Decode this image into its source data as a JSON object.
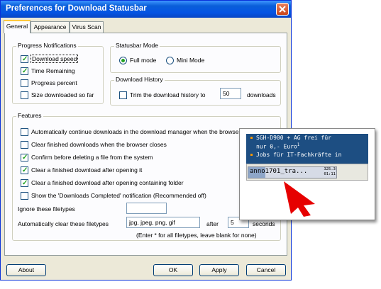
{
  "window": {
    "title": "Preferences for Download Statusbar"
  },
  "tabs": [
    {
      "label": "General",
      "active": true
    },
    {
      "label": "Appearance",
      "active": false
    },
    {
      "label": "Virus Scan",
      "active": false
    }
  ],
  "progress_notifications": {
    "legend": "Progress Notifications",
    "items": [
      {
        "label": "Download speed",
        "checked": true
      },
      {
        "label": "Time Remaining",
        "checked": true
      },
      {
        "label": "Progress percent",
        "checked": false
      },
      {
        "label": "Size downloaded so far",
        "checked": false
      }
    ]
  },
  "statusbar_mode": {
    "legend": "Statusbar Mode",
    "options": [
      {
        "label": "Full mode",
        "selected": true
      },
      {
        "label": "Mini Mode",
        "selected": false
      }
    ]
  },
  "download_history": {
    "legend": "Download History",
    "trim_label": "Trim the download history to",
    "trim_checked": false,
    "trim_value": "50",
    "suffix": "downloads"
  },
  "features": {
    "legend": "Features",
    "items": [
      {
        "label": "Automatically continue downloads in the download manager when the browser closes",
        "checked": false
      },
      {
        "label": "Clear finished downloads when the browser closes",
        "checked": false
      },
      {
        "label": "Confirm before deleting a file from the system",
        "checked": true
      },
      {
        "label": "Clear a finished download after opening it",
        "checked": true
      },
      {
        "label": "Clear a finished download after opening containing folder",
        "checked": true
      },
      {
        "label": "Show the 'Downloads Completed' notification (Recommended off)",
        "checked": false
      }
    ],
    "ignore_label": "Ignore these filetypes",
    "ignore_value": "",
    "autoclear_label": "Automatically clear these filetypes",
    "autoclear_value": "jpg, jpeg, png, gif",
    "after_label": "after",
    "after_value": "5",
    "seconds_label": "seconds",
    "hint": "(Enter * for all filetypes, leave blank for none)"
  },
  "buttons": {
    "about": "About",
    "ok": "OK",
    "apply": "Apply",
    "cancel": "Cancel"
  },
  "statusbar_preview": {
    "ad_line1": "SGH-D900 + AG frei für",
    "ad_line2": "nur 0,- Euro",
    "ad_sup": "1",
    "ad_line3": "Jobs für IT-Fachkräfte in",
    "download_name": "anno1701_tra...",
    "stat_size": "325.3",
    "stat_time": "01:11",
    "arrow_color": "#e60000",
    "accent_color": "#ff9900"
  }
}
